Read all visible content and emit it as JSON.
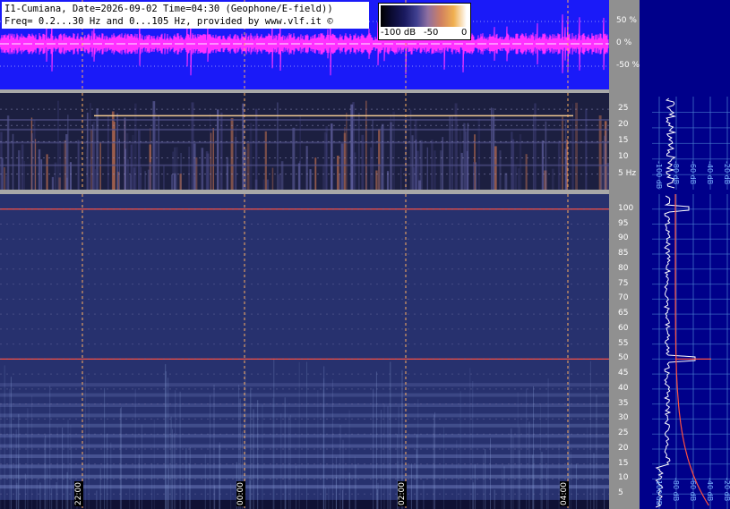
{
  "header": {
    "line1": "I1-Cumiana, Date=2026-09-02 Time=04:30 (Geophone/E-field))",
    "line2": "Freq= 0.2...30 Hz and 0...105 Hz, provided by www.vlf.it ©"
  },
  "colorbar": {
    "labels": [
      "-100 dB",
      "-50",
      "0"
    ]
  },
  "colors": {
    "waveform_bg": "#1a1af8",
    "waveform": "#ff30ff",
    "spectrogram_bg": "#27316e",
    "side_bg": "#00008a",
    "line_50hz": "#ff5040",
    "time_marker": "#ffb060",
    "grid": "#4a7fd0"
  },
  "chart_data": [
    {
      "type": "line",
      "panel": "waveform",
      "y_ticks": [
        "50 %",
        "0 %",
        "-50 %"
      ],
      "y_tick_values": [
        50,
        0,
        -50
      ],
      "ylim": [
        -100,
        100
      ]
    },
    {
      "type": "heatmap",
      "panel": "spectrogram-low",
      "y_ticks": [
        "25",
        "20",
        "15",
        "10",
        "5 Hz"
      ],
      "y_tick_values": [
        25,
        20,
        15,
        10,
        5
      ],
      "ylim": [
        0.2,
        30
      ]
    },
    {
      "type": "heatmap",
      "panel": "spectrogram-high",
      "y_ticks": [
        "100",
        "95",
        "90",
        "85",
        "80",
        "75",
        "70",
        "65",
        "60",
        "55",
        "50",
        "45",
        "40",
        "35",
        "30",
        "25",
        "20",
        "15",
        "10",
        "5"
      ],
      "y_tick_values": [
        100,
        95,
        90,
        85,
        80,
        75,
        70,
        65,
        60,
        55,
        50,
        45,
        40,
        35,
        30,
        25,
        20,
        15,
        10,
        5
      ],
      "ylim": [
        0,
        105
      ],
      "time_labels": [
        "22:00",
        "00:00",
        "02:00",
        "04:00"
      ],
      "lines": [
        {
          "name": "50 Hz",
          "y": 50
        },
        {
          "name": "100 Hz",
          "y": 100
        }
      ]
    },
    {
      "type": "line",
      "panel": "spectrum-side",
      "x_ticks": [
        "-100 dB",
        "-80 dB",
        "-60 dB",
        "-40 dB",
        "-20 dB"
      ],
      "x_tick_values": [
        -100,
        -80,
        -60,
        -40,
        -20
      ]
    }
  ]
}
